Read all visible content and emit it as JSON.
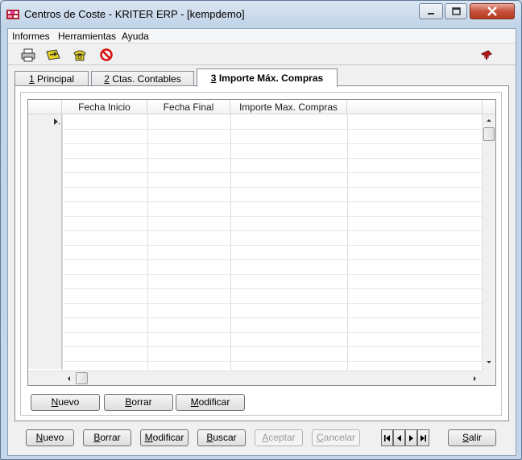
{
  "window": {
    "title": "Centros de Coste - KRITER ERP - [kempdemo]",
    "accent": "#c7523a"
  },
  "menu": {
    "items": [
      "Informes",
      "Herramientas",
      "Ayuda"
    ]
  },
  "toolbar": {
    "icons": [
      "print-icon",
      "export-icon",
      "phone-icon",
      "cancel-icon",
      "help-icon"
    ]
  },
  "tabs": [
    {
      "key": "1",
      "label": " Principal",
      "active": false
    },
    {
      "key": "2",
      "label": " Ctas. Contables",
      "active": false
    },
    {
      "key": "3",
      "label": " Importe Máx. Compras",
      "active": true
    }
  ],
  "grid": {
    "columns": [
      "Fecha Inicio",
      "Fecha Final",
      "Importe Max. Compras",
      ""
    ],
    "rows": []
  },
  "inner_buttons": {
    "nuevo": {
      "key": "N",
      "rest": "uevo"
    },
    "borrar": {
      "key": "B",
      "rest": "orrar"
    },
    "modificar": {
      "key": "M",
      "rest": "odificar"
    }
  },
  "footer_buttons": {
    "nuevo": {
      "key": "N",
      "rest": "uevo"
    },
    "borrar": {
      "key": "B",
      "rest": "orrar"
    },
    "modificar": {
      "key": "M",
      "rest": "odificar"
    },
    "buscar": {
      "key": "B",
      "rest": "uscar"
    },
    "aceptar": {
      "key": "A",
      "rest": "ceptar"
    },
    "cancelar": {
      "key": "C",
      "rest": "ancelar"
    },
    "salir": {
      "key": "S",
      "rest": "alir"
    }
  }
}
